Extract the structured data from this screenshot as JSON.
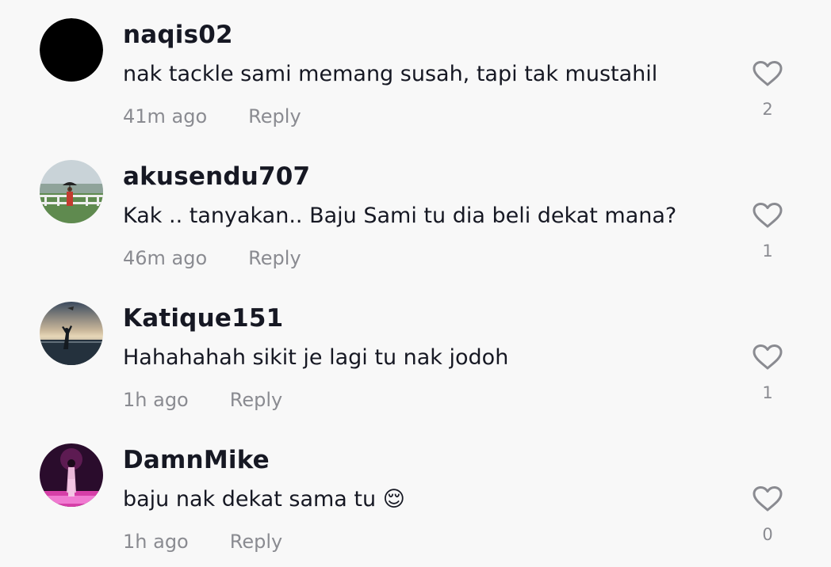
{
  "comments": [
    {
      "username": "naqis02",
      "text": "nak tackle sami memang susah, tapi tak mustahil",
      "time": "41m ago",
      "reply_label": "Reply",
      "likes": "2"
    },
    {
      "username": "akusendu707",
      "text": "Kak .. tanyakan.. Baju Sami tu dia beli dekat mana?",
      "time": "46m ago",
      "reply_label": "Reply",
      "likes": "1"
    },
    {
      "username": "Katique151",
      "text": "Hahahahah sikit je lagi tu nak jodoh",
      "time": "1h ago",
      "reply_label": "Reply",
      "likes": "1"
    },
    {
      "username": "DamnMike",
      "text": "baju nak dekat sama tu 😌",
      "time": "1h ago",
      "reply_label": "Reply",
      "likes": "0"
    }
  ]
}
